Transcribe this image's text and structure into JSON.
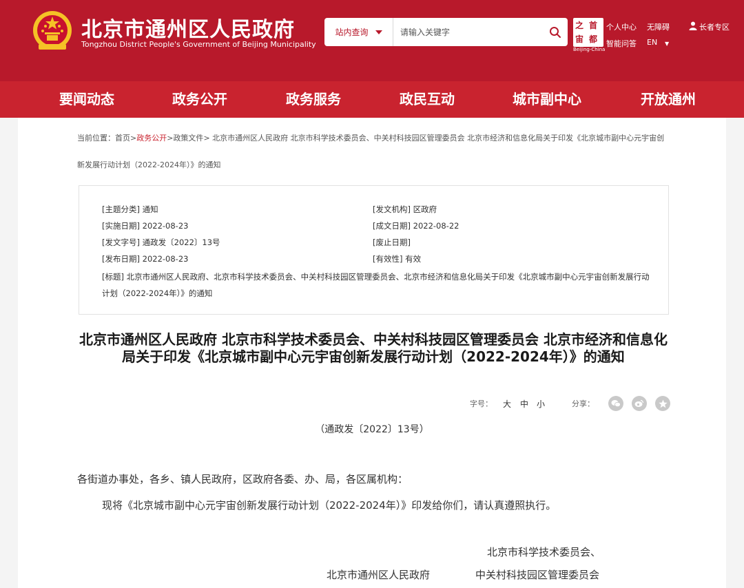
{
  "header": {
    "site_title": "北京市通州区人民政府",
    "site_subtitle": "Tongzhou District People's Government of Beijing Municipality",
    "search": {
      "scope": "站内查询",
      "placeholder": "请输入关键字"
    },
    "logo": {
      "chars": [
        "之",
        "首",
        "宙",
        "都"
      ],
      "caption": "Beijing-China"
    },
    "links": {
      "personal": "个人中心",
      "accessible": "无障碍",
      "senior": "长者专区",
      "qa": "智能问答",
      "lang": "EN",
      "lang_caret": "▼"
    }
  },
  "nav": [
    "要闻动态",
    "政务公开",
    "政务服务",
    "政民互动",
    "城市副中心",
    "开放通州"
  ],
  "breadcrumb": {
    "label": "当前位置：",
    "home": "首页",
    "sep": ">",
    "open": "政务公开",
    "policy": "政策文件",
    "current": "北京市通州区人民政府 北京市科学技术委员会、中关村科技园区管理委员会 北京市经济和信息化局关于印发《北京城市副中心元宇宙创新发展行动计划（2022-2024年）》的通知"
  },
  "meta": {
    "category": "[主题分类] 通知",
    "agency": "[发文机构] 区政府",
    "effective_date": "[实施日期] 2022-08-23",
    "written_date": "[成文日期] 2022-08-22",
    "doc_no": "[发文字号] 通政发〔2022〕13号",
    "repeal_date": "[废止日期]",
    "publish_date": "[发布日期] 2022-08-23",
    "validity": "[有效性] 有效",
    "title": "[标题] 北京市通州区人民政府、北京市科学技术委员会、中关村科技园区管理委员会、北京市经济和信息化局关于印发《北京城市副中心元宇宙创新发展行动计划（2022-2024年）》的通知"
  },
  "document": {
    "title": "北京市通州区人民政府 北京市科学技术委员会、中关村科技园区管理委员会 北京市经济和信息化局关于印发《北京城市副中心元宇宙创新发展行动计划（2022-2024年）》的通知",
    "font_size_label": "字号：",
    "sizes": [
      "大",
      "中",
      "小"
    ],
    "share_label": "分享：",
    "doc_number": "（通政发〔2022〕13号）",
    "salutation": "各街道办事处，各乡、镇人民政府，区政府各委、办、局，各区属机构：",
    "body": "现将《北京城市副中心元宇宙创新发展行动计划（2022-2024年）》印发给你们，请认真遵照执行。",
    "signature_1": "北京市科学技术委员会、",
    "signature_2": "北京市通州区人民政府",
    "signature_3": "中关村科技园区管理委员会"
  },
  "colors": {
    "header_red": "#b8192b",
    "nav_red": "#c9232f",
    "emblem_gold": "#f5c226"
  }
}
